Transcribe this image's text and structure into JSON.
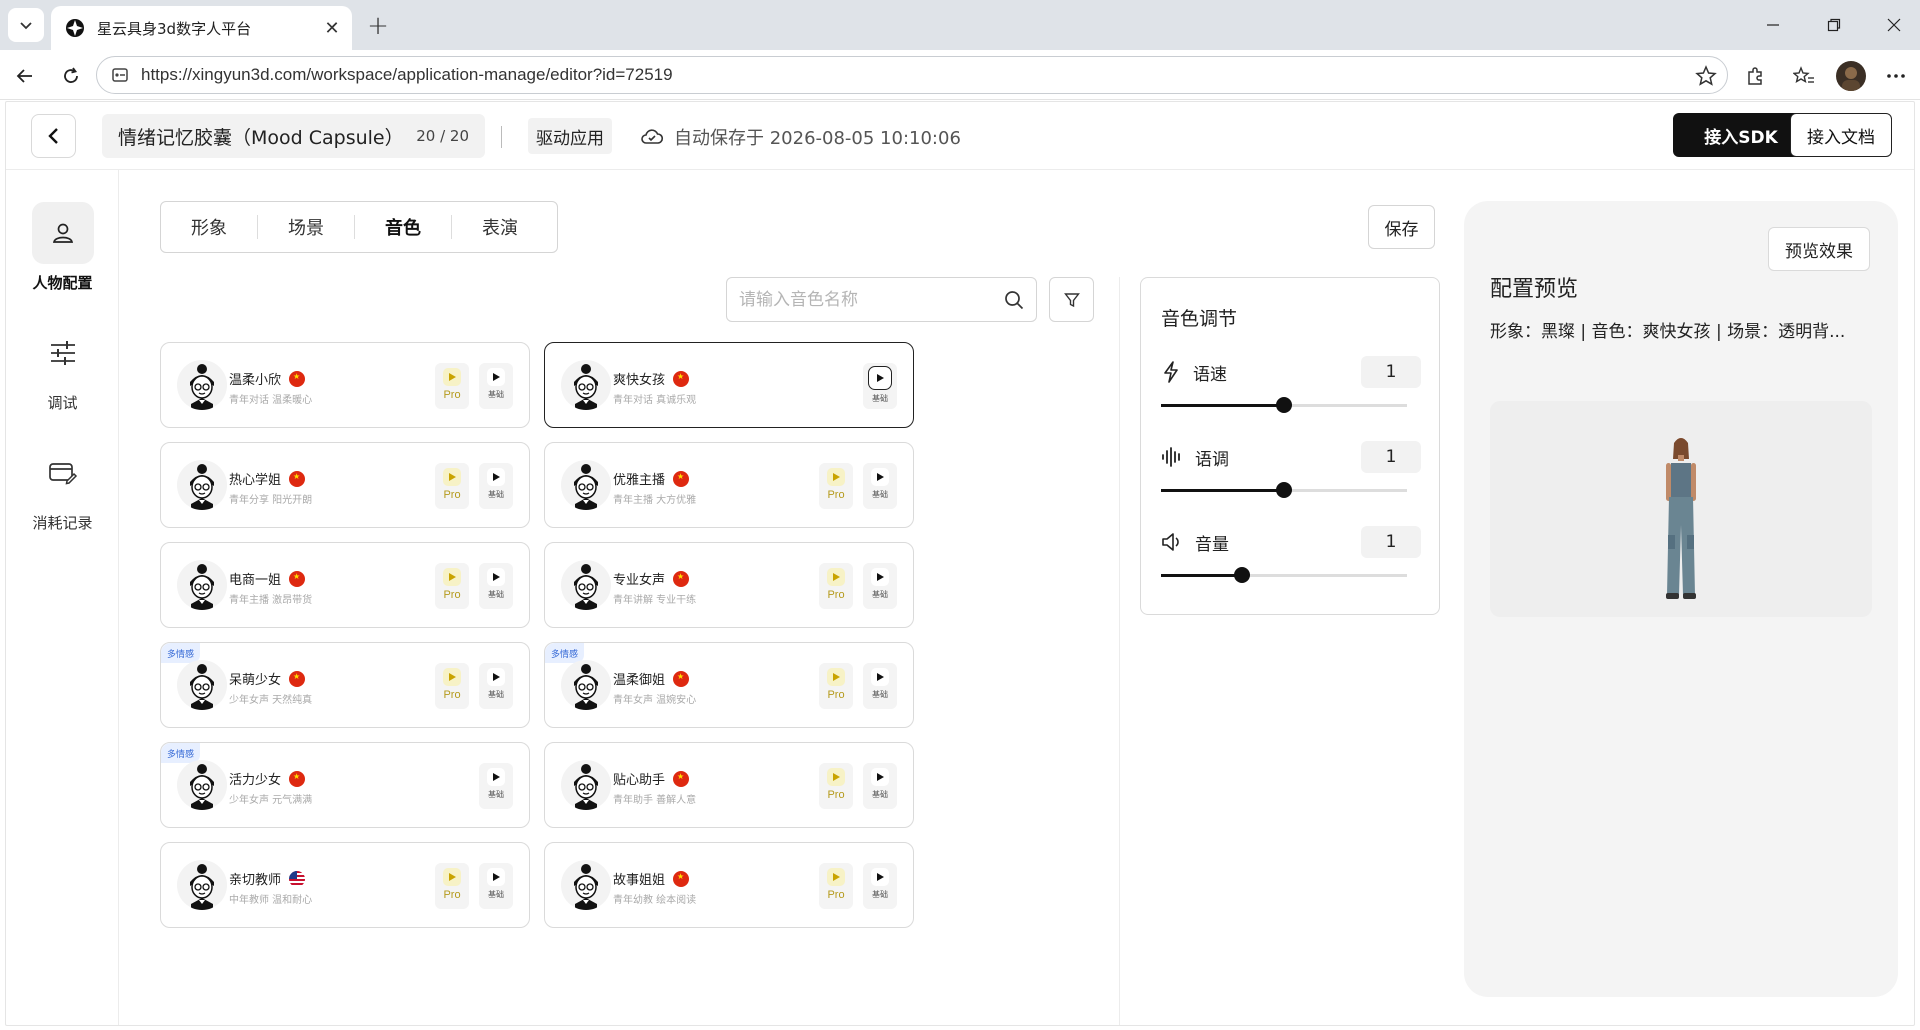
{
  "browser": {
    "tab_title": "星云具身3d数字人平台",
    "url": "https://xingyun3d.com/workspace/application-manage/editor?id=72519"
  },
  "header": {
    "app_name": "情绪记忆胶囊（Mood Capsule）",
    "name_count": "20 / 20",
    "drive_label": "驱动应用",
    "autosave": "自动保存于 2026-08-05 10:10:06",
    "sdk_label": "接入SDK",
    "doc_label": "接入文档"
  },
  "leftnav": [
    {
      "label": "人物配置",
      "icon": "person-icon",
      "active": true
    },
    {
      "label": "调试",
      "icon": "sliders-icon",
      "active": false
    },
    {
      "label": "消耗记录",
      "icon": "card-edit-icon",
      "active": false
    }
  ],
  "tabs": [
    {
      "label": "形象"
    },
    {
      "label": "场景"
    },
    {
      "label": "音色"
    },
    {
      "label": "表演"
    }
  ],
  "active_tab": "音色",
  "save_label": "保存",
  "search": {
    "placeholder": "请输入音色名称"
  },
  "badges": {
    "pro": "Pro",
    "basic": "基础",
    "multi": "多情感"
  },
  "colors": {
    "accent": "#111111",
    "pro_gold": "#b59a1b",
    "multi_blue": "#3569d6"
  },
  "voices": [
    {
      "name": "温柔小欣",
      "desc": "青年对话 温柔暖心",
      "flag": "cn",
      "pro": true,
      "multi": false,
      "selected": false
    },
    {
      "name": "爽快女孩",
      "desc": "青年对话 真诚乐观",
      "flag": "cn",
      "pro": false,
      "multi": false,
      "selected": true
    },
    {
      "name": "热心学姐",
      "desc": "青年分享 阳光开朗",
      "flag": "cn",
      "pro": true,
      "multi": false,
      "selected": false
    },
    {
      "name": "优雅主播",
      "desc": "青年主播 大方优雅",
      "flag": "cn",
      "pro": true,
      "multi": false,
      "selected": false
    },
    {
      "name": "电商一姐",
      "desc": "青年主播 激昂带货",
      "flag": "cn",
      "pro": true,
      "multi": false,
      "selected": false
    },
    {
      "name": "专业女声",
      "desc": "青年讲解 专业干练",
      "flag": "cn",
      "pro": true,
      "multi": false,
      "selected": false
    },
    {
      "name": "呆萌少女",
      "desc": "少年女声 天然纯真",
      "flag": "cn",
      "pro": true,
      "multi": true,
      "selected": false
    },
    {
      "name": "温柔御姐",
      "desc": "青年女声 温婉安心",
      "flag": "cn",
      "pro": true,
      "multi": true,
      "selected": false
    },
    {
      "name": "活力少女",
      "desc": "少年女声 元气满满",
      "flag": "cn",
      "pro": false,
      "multi": true,
      "selected": false
    },
    {
      "name": "贴心助手",
      "desc": "青年助手 善解人意",
      "flag": "cn",
      "pro": true,
      "multi": false,
      "selected": false
    },
    {
      "name": "亲切教师",
      "desc": "中年教师 温和耐心",
      "flag": "us",
      "pro": true,
      "multi": false,
      "selected": false
    },
    {
      "name": "故事姐姐",
      "desc": "青年幼教 绘本阅读",
      "flag": "cn",
      "pro": true,
      "multi": false,
      "selected": false
    }
  ],
  "tone": {
    "title": "音色调节",
    "sliders": [
      {
        "label": "语速",
        "value": "1",
        "level": 0.5,
        "icon": "lightning-icon"
      },
      {
        "label": "语调",
        "value": "1",
        "level": 0.5,
        "icon": "waveform-icon"
      },
      {
        "label": "音量",
        "value": "1",
        "level": 0.33,
        "icon": "speaker-icon"
      }
    ]
  },
  "preview": {
    "button": "预览效果",
    "title": "配置预览",
    "summary": "形象：黑璨 | 音色：爽快女孩 | 场景：透明背..."
  }
}
